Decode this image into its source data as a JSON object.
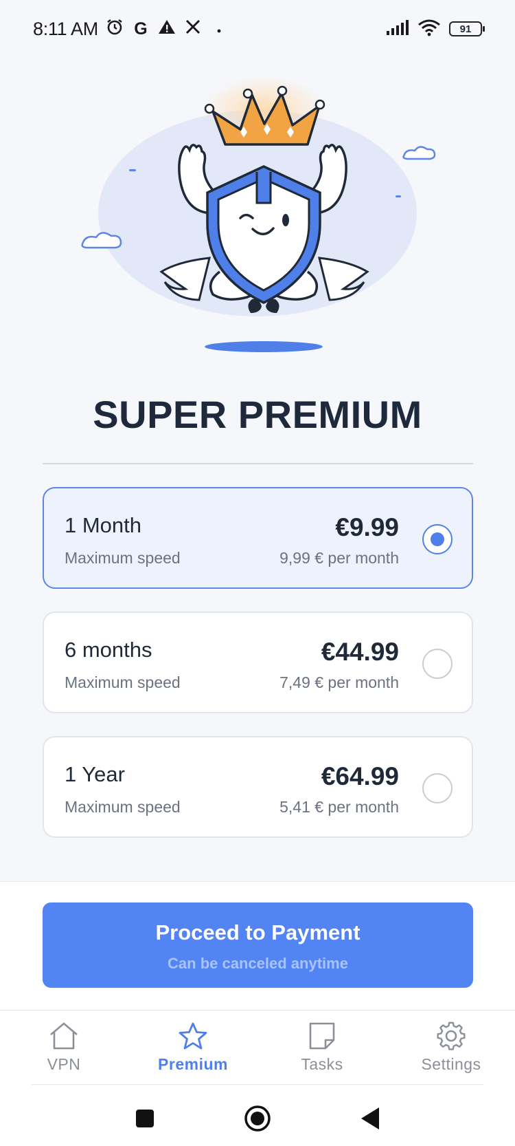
{
  "status_bar": {
    "time": "8:11 AM",
    "notification_icons": [
      "alarm-icon",
      "google-icon",
      "warning-icon",
      "x-icon",
      "dot-icon"
    ],
    "battery": "91"
  },
  "title": "SUPER PREMIUM",
  "plans": [
    {
      "name": "1 Month",
      "desc": "Maximum speed",
      "price": "€9.99",
      "per": "9,99 € per month",
      "selected": true
    },
    {
      "name": "6 months",
      "desc": "Maximum speed",
      "price": "€44.99",
      "per": "7,49 € per month",
      "selected": false
    },
    {
      "name": "1 Year",
      "desc": "Maximum speed",
      "price": "€64.99",
      "per": "5,41 € per month",
      "selected": false
    }
  ],
  "cta": {
    "title": "Proceed to Payment",
    "subtitle": "Can be canceled anytime"
  },
  "nav": {
    "items": [
      {
        "label": "VPN",
        "icon": "home-icon",
        "active": false
      },
      {
        "label": "Premium",
        "icon": "star-icon",
        "active": true
      },
      {
        "label": "Tasks",
        "icon": "note-icon",
        "active": false
      },
      {
        "label": "Settings",
        "icon": "gear-icon",
        "active": false
      }
    ]
  },
  "colors": {
    "accent": "#5284f3",
    "selected_bg": "#eef2fc",
    "crown": "#f2a444",
    "shield": "#4f7fe8"
  }
}
